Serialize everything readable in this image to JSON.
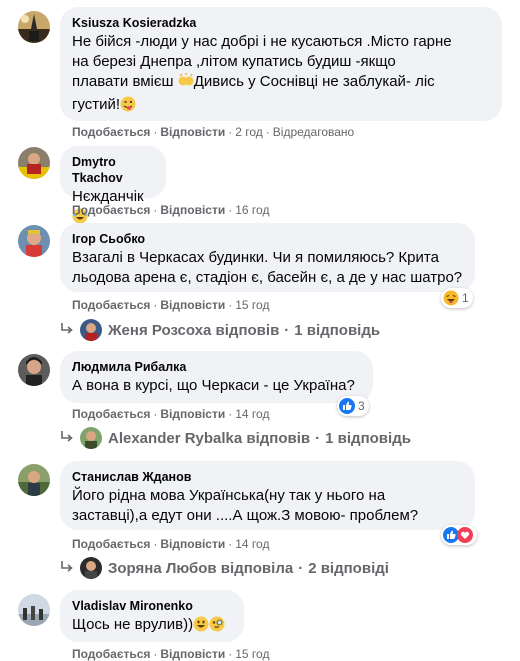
{
  "labels": {
    "like": "Подобається",
    "reply": "Відповісти"
  },
  "comments": [
    {
      "author": "Ksiusza Kosieradzka",
      "text": "Не бійся -люди у нас добрі і не кусаються .Місто гарне на березі Днепра ,літом купатись будиш -якщо плавати вмієш 🙌Дивись у Соснівці не заблукай- ліс густий!😜",
      "text_lines": [
        "Не бійся -люди у нас добрі і не кусаються .Місто гарне",
        "на березі Днепра ,літом купатись будиш -якщо",
        "плавати вмієш ",
        "Дивись у Соснівці не заблукай- ліс",
        "густий!"
      ],
      "time": "2 год",
      "edited": "Відредаговано"
    },
    {
      "author": "Dmytro Tkachov",
      "text": "Нєжданчік",
      "time": "16 год"
    },
    {
      "author": "Ігор Сьобко",
      "text_lines": [
        "Взагалі в Черкасах будинки. Чи я помиляюсь? Крита",
        "льодова арена є, стадіон є, басейн є, а де у нас шатро?"
      ],
      "time": "15 год",
      "reactions": {
        "icon": "haha-icon",
        "count": "1"
      },
      "reply_summary": {
        "name": "Женя Розсоха відповів",
        "count": "1 відповідь"
      }
    },
    {
      "author": "Людмила Рибалка",
      "text": "А вона в курсі, що Черкаси - це Україна?",
      "time": "14 год",
      "reactions": {
        "icon": "like-icon",
        "count": "3"
      },
      "reply_summary": {
        "name": "Alexander Rybalka відповів",
        "count": "1 відповідь"
      }
    },
    {
      "author": "Станислав Жданов",
      "text_lines": [
        "Його рідна мова Українська(ну так у нього на",
        "заставці),а едут они ....А щож.З мовою- проблем?"
      ],
      "time": "14 год",
      "reactions": {
        "icon": "like-icon",
        "count": ""
      },
      "reply_summary": {
        "name": "Зоряна Любов відповіла",
        "count": "2 відповіді"
      }
    },
    {
      "author": "Vladislav Mironenko",
      "text": "Щось не врулив))",
      "time": "15 год"
    }
  ],
  "colors": {
    "bubble": "#f0f2f5",
    "meta": "#65676b",
    "like_blue": "#1877f2",
    "text": "#050505"
  }
}
